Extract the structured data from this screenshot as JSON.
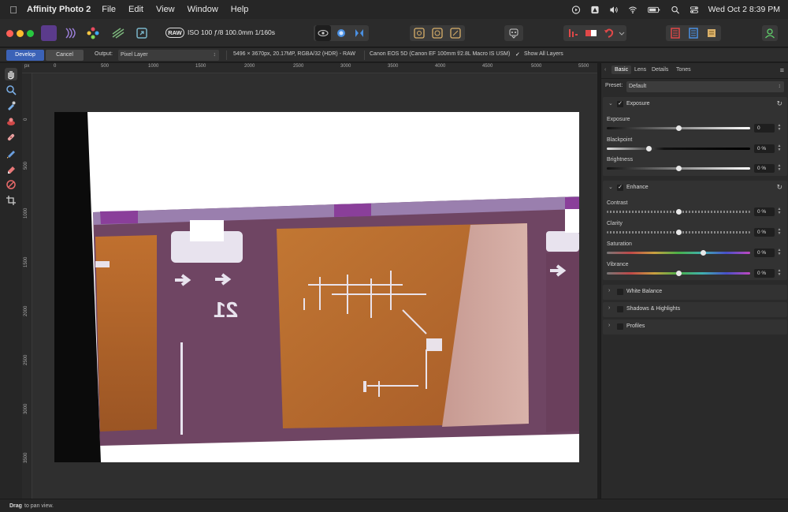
{
  "menubar": {
    "app_name": "Affinity Photo 2",
    "items": [
      "File",
      "Edit",
      "View",
      "Window",
      "Help"
    ],
    "clock": "Wed Oct 2  8:39 PM"
  },
  "toolbar": {
    "raw_badge": "RAW",
    "raw_info": "ISO 100 ƒ/8 100.0mm 1/160s"
  },
  "context": {
    "develop_label": "Develop",
    "cancel_label": "Cancel",
    "output_label": "Output:",
    "output_value": "Pixel Layer",
    "image_info": "5496 × 3670px, 20.17MP, RGBA/32 (HDR) - RAW",
    "camera_info": "Canon EOS 5D (Canon EF 100mm f/2.8L Macro IS USM)",
    "show_all_layers": "Show All Layers"
  },
  "ruler": {
    "unit": "px",
    "h_ticks": [
      "0",
      "500",
      "1000",
      "1500",
      "2000",
      "2500",
      "3000",
      "3500",
      "4000",
      "4500",
      "5000",
      "5500"
    ],
    "v_ticks": [
      "0",
      "500",
      "1000",
      "1500",
      "2000",
      "2500",
      "3000",
      "3500"
    ]
  },
  "film": {
    "frame_number": "21"
  },
  "panel": {
    "tabs": [
      "Basic",
      "Lens",
      "Details",
      "Tones"
    ],
    "preset_label": "Preset:",
    "preset_value": "Default",
    "exposure": {
      "title": "Exposure",
      "sliders": [
        {
          "label": "Exposure",
          "value": "0",
          "level": 0.5
        },
        {
          "label": "Blackpoint",
          "value": "0 %",
          "level": 0.29
        },
        {
          "label": "Brightness",
          "value": "0 %",
          "level": 0.5
        }
      ]
    },
    "enhance": {
      "title": "Enhance",
      "sliders": [
        {
          "label": "Contrast",
          "value": "0 %",
          "level": 0.5
        },
        {
          "label": "Clarity",
          "value": "0 %",
          "level": 0.5
        },
        {
          "label": "Saturation",
          "value": "0 %",
          "level": 0.67
        },
        {
          "label": "Vibrance",
          "value": "0 %",
          "level": 0.5
        }
      ]
    },
    "collapsed": [
      "White Balance",
      "Shadows & Highlights",
      "Profiles"
    ]
  },
  "status": {
    "bold": "Drag",
    "text": "to pan view."
  },
  "colors": {
    "accent": "#3b62b7",
    "panel_bg": "#2a2a2a",
    "film_base": "#7a4f6e",
    "film_orange": "#b4612e"
  }
}
